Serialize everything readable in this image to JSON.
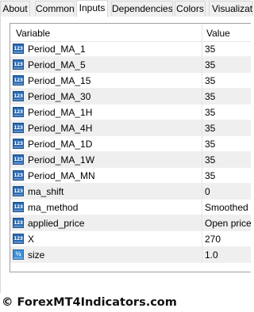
{
  "tabs": [
    {
      "label": "About"
    },
    {
      "label": "Common"
    },
    {
      "label": "Inputs",
      "active": true
    },
    {
      "label": "Dependencies"
    },
    {
      "label": "Colors"
    },
    {
      "label": "Visualization"
    }
  ],
  "grid": {
    "headers": {
      "variable": "Variable",
      "value": "Value"
    },
    "rows": [
      {
        "icon": "integer-icon",
        "icon_text": "123",
        "name": "Period_MA_1",
        "value": "35"
      },
      {
        "icon": "integer-icon",
        "icon_text": "123",
        "name": "Period_MA_5",
        "value": "35"
      },
      {
        "icon": "integer-icon",
        "icon_text": "123",
        "name": "Period_MA_15",
        "value": "35"
      },
      {
        "icon": "integer-icon",
        "icon_text": "123",
        "name": "Period_MA_30",
        "value": "35"
      },
      {
        "icon": "integer-icon",
        "icon_text": "123",
        "name": "Period_MA_1H",
        "value": "35"
      },
      {
        "icon": "integer-icon",
        "icon_text": "123",
        "name": "Period_MA_4H",
        "value": "35"
      },
      {
        "icon": "integer-icon",
        "icon_text": "123",
        "name": "Period_MA_1D",
        "value": "35"
      },
      {
        "icon": "integer-icon",
        "icon_text": "123",
        "name": "Period_MA_1W",
        "value": "35"
      },
      {
        "icon": "integer-icon",
        "icon_text": "123",
        "name": "Period_MA_MN",
        "value": "35"
      },
      {
        "icon": "integer-icon",
        "icon_text": "123",
        "name": "ma_shift",
        "value": "0"
      },
      {
        "icon": "integer-icon",
        "icon_text": "123",
        "name": "ma_method",
        "value": "Smoothed"
      },
      {
        "icon": "integer-icon",
        "icon_text": "123",
        "name": "applied_price",
        "value": "Open price"
      },
      {
        "icon": "integer-icon",
        "icon_text": "123",
        "name": "X",
        "value": "270"
      },
      {
        "icon": "double-icon",
        "icon_text": "½",
        "name": "size",
        "value": "1.0"
      }
    ]
  },
  "watermark": "© ForexMT4Indicators.com",
  "colors": {
    "integer_icon": "#2a6ab3",
    "double_icon": "#3d8fd4",
    "alt_row": "#efefef"
  }
}
